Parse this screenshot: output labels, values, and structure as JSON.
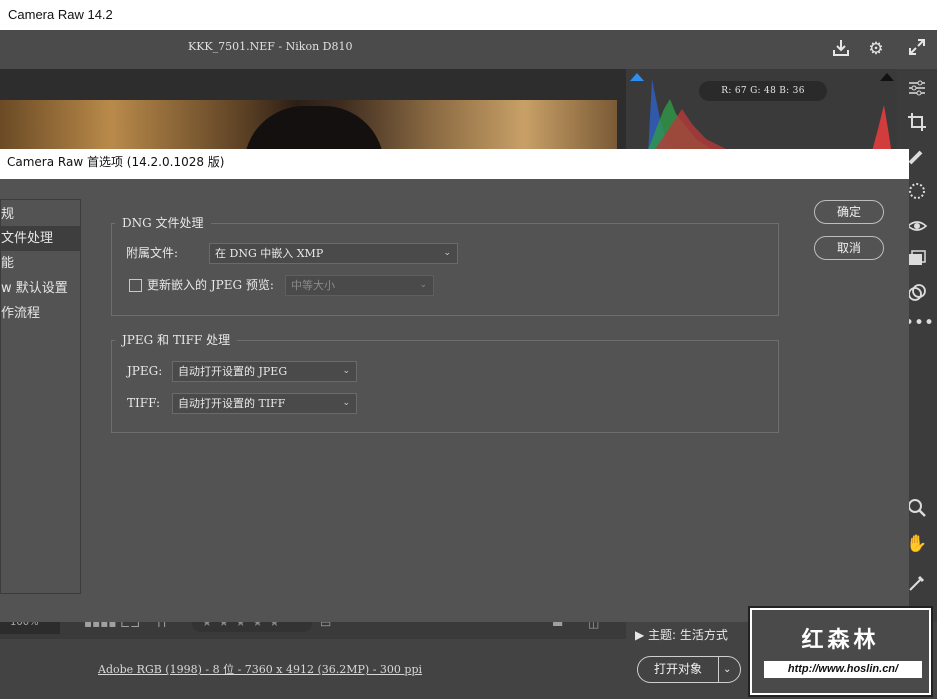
{
  "window": {
    "title": "Camera Raw 14.2"
  },
  "header": {
    "file_title": "KKK_7501.NEF -  Nikon D810"
  },
  "histogram": {
    "readout": "R: 67   G: 48   B: 36"
  },
  "filmstrip": {
    "zoom": "100%",
    "stars": "★★★★★"
  },
  "footer": {
    "theme_label": "主题: 生活方式",
    "image_info": "Adobe RGB (1998) - 8 位 - 7360 x 4912 (36.2MP) - 300 ppi",
    "open_button": "打开对象"
  },
  "dialog": {
    "title": "Camera Raw 首选项  (14.2.0.1028 版)",
    "nav": [
      {
        "label": "规",
        "selected": false
      },
      {
        "label": "文件处理",
        "selected": true
      },
      {
        "label": "能",
        "selected": false
      },
      {
        "label": "w 默认设置",
        "selected": false
      },
      {
        "label": "作流程",
        "selected": false
      }
    ],
    "dng_group": {
      "title": "DNG 文件处理",
      "sidecar_label": "附属文件:",
      "sidecar_value": "在 DNG 中嵌入 XMP",
      "update_jpeg_label": "更新嵌入的 JPEG 预览:",
      "preview_size_value": "中等大小"
    },
    "jpeg_tiff_group": {
      "title": "JPEG 和 TIFF 处理",
      "jpeg_label": "JPEG:",
      "jpeg_value": "自动打开设置的 JPEG",
      "tiff_label": "TIFF:",
      "tiff_value": "自动打开设置的 TIFF"
    },
    "ok_button": "确定",
    "cancel_button": "取消"
  },
  "watermark": {
    "name": "红森林",
    "url": "http://www.hoslin.cn/"
  },
  "colors": {
    "panel": "#535353",
    "toolbar": "#4b4b4b",
    "dark": "#2d2d2d"
  },
  "icons": {
    "export": "download-icon",
    "settings": "gear-icon",
    "fullscreen": "expand-icon",
    "tools": [
      "sliders-icon",
      "crop-icon",
      "healing-icon",
      "mask-icon",
      "redeye-icon",
      "presets-icon",
      "snapshot-icon",
      "more-icon",
      "zoom-icon",
      "hand-icon",
      "eyedropper-icon",
      "grid-icon"
    ]
  }
}
